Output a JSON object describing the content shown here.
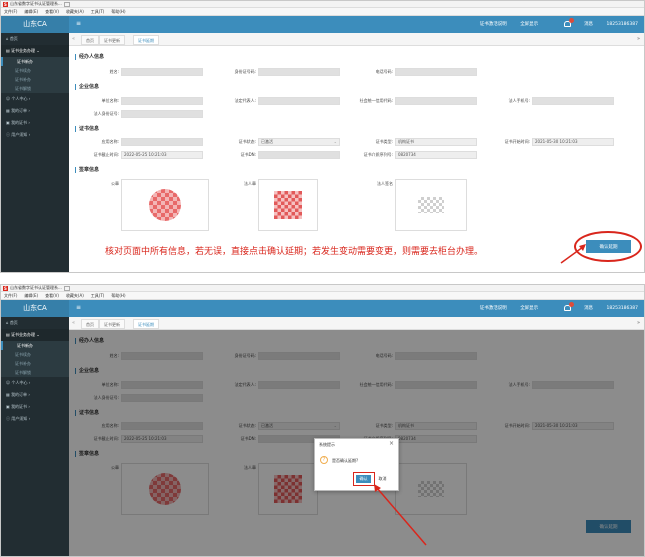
{
  "browser": {
    "title": "山东省数字证书认证管理系...",
    "menus": [
      "文件(F)",
      "编辑(E)",
      "查看(V)",
      "收藏夹(A)",
      "工具(T)",
      "帮助(H)"
    ]
  },
  "header": {
    "logo": "山东CA",
    "nav": [
      "证书激活说明",
      "全屏显示",
      "消息"
    ],
    "phone": "18253186387",
    "badge_color": "#dd4b39"
  },
  "sidebar": {
    "items": [
      {
        "label": "首页",
        "icon": "home-icon"
      },
      {
        "label": "证书业务办理",
        "icon": "certificate-icon",
        "open": true,
        "children": [
          "证书新办",
          "证书续办",
          "证书补办",
          "证书解锁"
        ]
      },
      {
        "label": "个人中心",
        "icon": "user-icon"
      },
      {
        "label": "我的订单",
        "icon": "order-icon"
      },
      {
        "label": "我的证书",
        "icon": "card-icon"
      },
      {
        "label": "用户须知",
        "icon": "info-icon"
      }
    ]
  },
  "tabs": {
    "items": [
      "首页",
      "证书更新",
      "证书延期"
    ]
  },
  "form": {
    "sections": [
      "经办人信息",
      "企业信息",
      "证书信息",
      "签章信息"
    ],
    "agent": {
      "name": "姓名:",
      "id_no": "身份证号码:",
      "phone": "电话号码:"
    },
    "company": {
      "unit_name": "单位名称:",
      "legal_rep": "法定代表人:",
      "credit_code": "社会统一信用代码:",
      "legal_phone": "法人手机号:",
      "legal_id": "法人身份证号:"
    },
    "cert": {
      "app_name": "应用名称:",
      "cert_status": "证书状态:",
      "cert_status_value": "已激活",
      "cert_type": "证书类型:",
      "cert_type_value": "机构证书",
      "start_time": "证书开始时间:",
      "start_time_value": "2021-05-30 10:21:03",
      "expire_time": "证书截止时间:",
      "expire_time_value": "2022-05-25 10:21:03",
      "cert_dn": "证书DN:",
      "medium_no": "证书介质序列号:",
      "medium_no_value": "0820734"
    },
    "seal": {
      "official": "公章",
      "legal": "法人章",
      "legal_sign": "法人签名"
    }
  },
  "note": "核对页面中所有信息，若无误，直接点击确认延期；若发生变动需要变更，则需要去柜台办理。",
  "confirm_button": "确认延期",
  "dialog": {
    "title": "系统提示",
    "message": "是否确认延期?",
    "ok": "确认",
    "cancel": "取消"
  },
  "accent_color": "#3c8dbc",
  "annotation_color": "#d9261c"
}
